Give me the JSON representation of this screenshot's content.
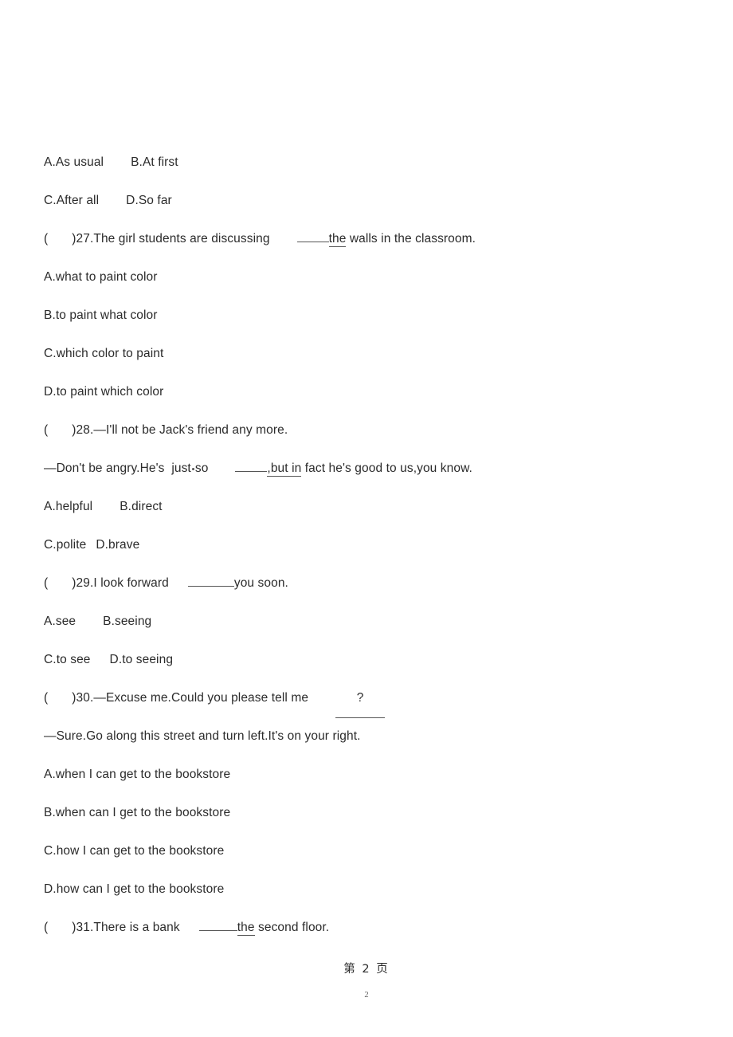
{
  "document": {
    "page_label": "第 2 页",
    "page_number_footer": "2",
    "text_color": "#2b2b2b",
    "rule_color": "#555555"
  },
  "lines": [
    {
      "id": "opts-26-ab",
      "type": "options",
      "left": "A.As usual",
      "right": "B.At first"
    },
    {
      "id": "opts-26-cd",
      "type": "options",
      "left": "C.After all",
      "right": "D.So far"
    },
    {
      "id": "q27-stem",
      "type": "question",
      "paren_open": "(",
      "paren_close": ")",
      "number": "27.",
      "text_before": "The girl students are discussing",
      "underlined_word": "the",
      "text_after": " walls in the classroom."
    },
    {
      "id": "q27-a",
      "type": "option",
      "text": "A.what to paint color"
    },
    {
      "id": "q27-b",
      "type": "option",
      "text": "B.to paint what color"
    },
    {
      "id": "q27-c",
      "type": "option",
      "text": "C.which color to paint"
    },
    {
      "id": "q27-d",
      "type": "option",
      "text": "D.to paint which color"
    },
    {
      "id": "q28-stem",
      "type": "question",
      "paren_open": "(",
      "paren_close": ")",
      "number": "28.",
      "text_before": "—I'll not be Jack's friend any more."
    },
    {
      "id": "q28-reply",
      "type": "dialogue",
      "text_before": "—Don't be angry.He's  just",
      "text_mid": "so",
      "underlined_run": ",but in",
      "text_after": " fact he's good to us,you know."
    },
    {
      "id": "q28-ab",
      "type": "options",
      "left": "A.helpful",
      "right": "B.direct"
    },
    {
      "id": "q28-cd",
      "type": "options-narrow",
      "left": "C.polite",
      "right": "D.brave"
    },
    {
      "id": "q29-stem",
      "type": "question",
      "paren_open": "(",
      "paren_close": ")",
      "number": "29.",
      "text_before": "I look forward",
      "text_after": "you soon."
    },
    {
      "id": "q29-ab",
      "type": "options",
      "left": "A.see",
      "right": "B.seeing"
    },
    {
      "id": "q29-cd",
      "type": "options",
      "left": "C.to see",
      "right": "D.to seeing"
    },
    {
      "id": "q30-stem",
      "type": "question",
      "paren_open": "(",
      "paren_close": ")",
      "number": "30.",
      "text_before": "—Excuse me.Could you please tell me",
      "blank_content": "?"
    },
    {
      "id": "q30-reply",
      "type": "dialogue",
      "text_before": "—Sure.Go along this street and turn left.It's on your right."
    },
    {
      "id": "q30-a",
      "type": "option",
      "text": "A.when I can get to the bookstore"
    },
    {
      "id": "q30-b",
      "type": "option",
      "text": "B.when can I get to the bookstore"
    },
    {
      "id": "q30-c",
      "type": "option",
      "text": "C.how I can get to the bookstore"
    },
    {
      "id": "q30-d",
      "type": "option",
      "text": "D.how can I get to the bookstore"
    },
    {
      "id": "q31-stem",
      "type": "question",
      "paren_open": "(",
      "paren_close": ")",
      "number": "31.",
      "text_before": "There is a bank",
      "underlined_word": "the",
      "text_after": " second floor."
    }
  ]
}
